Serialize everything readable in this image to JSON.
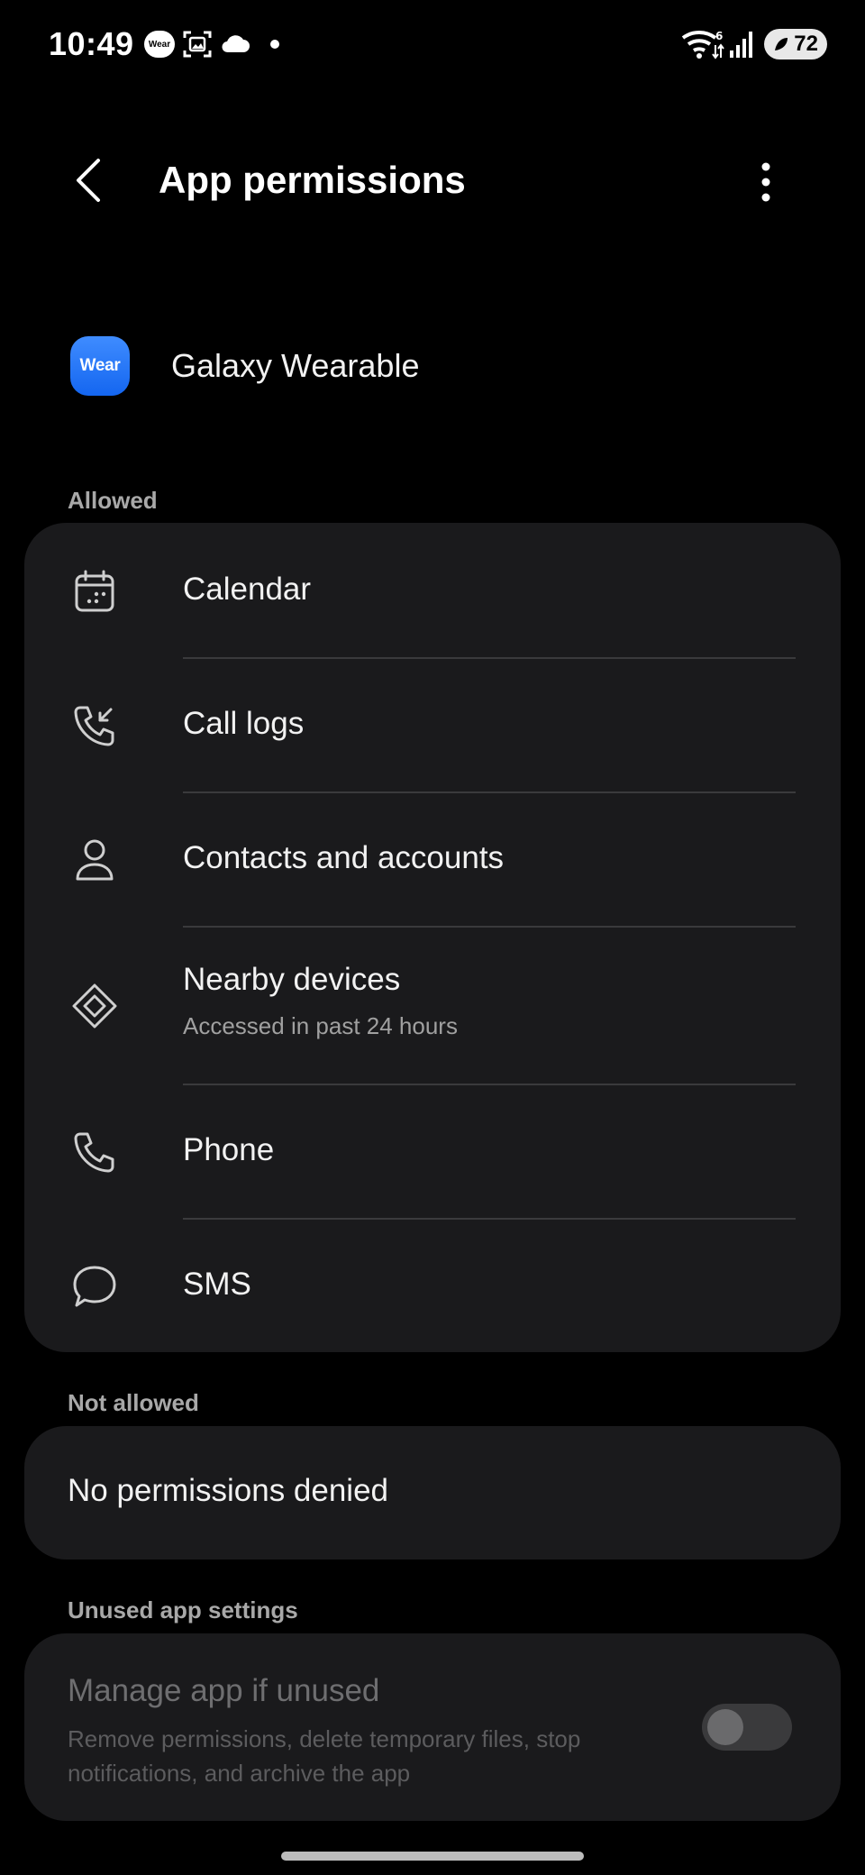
{
  "status_bar": {
    "time": "10:49",
    "wear_badge": "Wear",
    "battery_level": "72",
    "wifi_badge": "6",
    "icons": [
      "wear-badge",
      "gallery-scan-icon",
      "cloud-icon",
      "notification-dot",
      "wifi-icon",
      "signal-icon",
      "battery-icon"
    ]
  },
  "header": {
    "title": "App permissions",
    "back_icon": "chevron-left-icon",
    "more_icon": "more-vertical-icon"
  },
  "app": {
    "name": "Galaxy Wearable",
    "icon_text": "Wear",
    "icon_color": "#1a6ff5"
  },
  "allowed": {
    "label": "Allowed",
    "items": [
      {
        "label": "Calendar",
        "icon": "calendar-icon"
      },
      {
        "label": "Call logs",
        "icon": "call-log-icon"
      },
      {
        "label": "Contacts and accounts",
        "icon": "person-icon"
      },
      {
        "label": "Nearby devices",
        "sublabel": "Accessed in past 24 hours",
        "icon": "nearby-devices-icon"
      },
      {
        "label": "Phone",
        "icon": "phone-icon"
      },
      {
        "label": "SMS",
        "icon": "chat-bubble-icon"
      }
    ]
  },
  "not_allowed": {
    "label": "Not allowed",
    "empty_text": "No permissions denied"
  },
  "unused": {
    "label": "Unused app settings",
    "title": "Manage app if unused",
    "description": "Remove permissions, delete temporary files, stop notifications, and archive the app",
    "toggle_on": false
  },
  "colors": {
    "background": "#000000",
    "card": "#1a1a1c",
    "section_label": "#a8a8a8",
    "divider": "#3a3a3c"
  }
}
